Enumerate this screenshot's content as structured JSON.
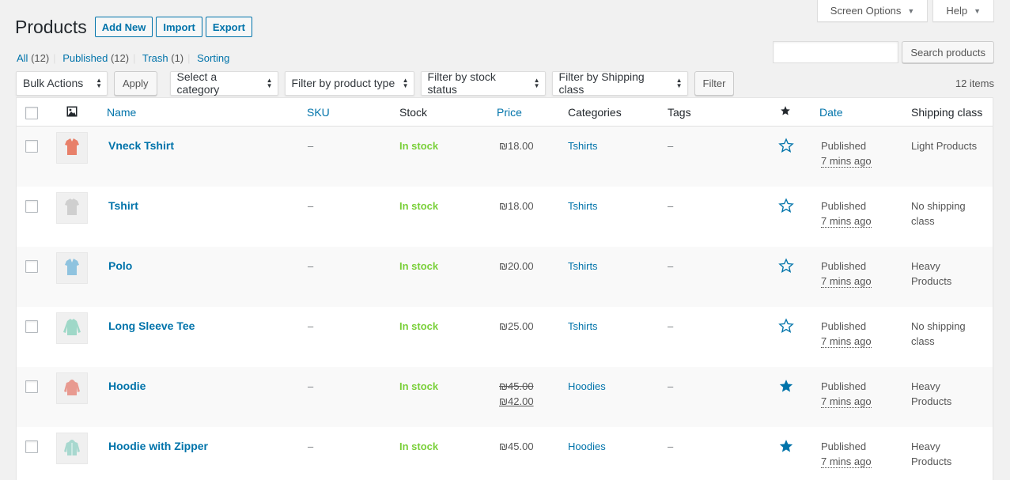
{
  "screen_meta": {
    "screen_options": "Screen Options",
    "help": "Help"
  },
  "header": {
    "title": "Products",
    "add_new": "Add New",
    "import": "Import",
    "export": "Export"
  },
  "views": {
    "all": "All",
    "all_count": "(12)",
    "published": "Published",
    "published_count": "(12)",
    "trash": "Trash",
    "trash_count": "(1)",
    "sorting": "Sorting",
    "separator": "|"
  },
  "search": {
    "value": "",
    "button": "Search products"
  },
  "tablenav": {
    "bulk_actions": "Bulk Actions",
    "apply": "Apply",
    "category": "Select a category",
    "product_type": "Filter by product type",
    "stock_status": "Filter by stock status",
    "shipping_class": "Filter by Shipping class",
    "filter": "Filter",
    "items": "12 items"
  },
  "columns": {
    "name": "Name",
    "sku": "SKU",
    "stock": "Stock",
    "price": "Price",
    "categories": "Categories",
    "tags": "Tags",
    "date": "Date",
    "shipping": "Shipping class"
  },
  "colors": {
    "accent": "#0073aa",
    "instock": "#7ad03a"
  },
  "rows": [
    {
      "name": "Vneck Tshirt",
      "sku": "–",
      "stock": "In stock",
      "price": "₪18.00",
      "price_regular": "",
      "category": "Tshirts",
      "tags": "–",
      "featured": false,
      "status": "Published",
      "time": "7 mins ago",
      "shipping_line1": "Light Products",
      "shipping_line2": "",
      "thumb_icon": "vneck-tshirt-icon",
      "thumb_color": "#e8806a"
    },
    {
      "name": "Tshirt",
      "sku": "–",
      "stock": "In stock",
      "price": "₪18.00",
      "price_regular": "",
      "category": "Tshirts",
      "tags": "–",
      "featured": false,
      "status": "Published",
      "time": "7 mins ago",
      "shipping_line1": "No shipping",
      "shipping_line2": "class",
      "thumb_icon": "tshirt-icon",
      "thumb_color": "#cfcfcf"
    },
    {
      "name": "Polo",
      "sku": "–",
      "stock": "In stock",
      "price": "₪20.00",
      "price_regular": "",
      "category": "Tshirts",
      "tags": "–",
      "featured": false,
      "status": "Published",
      "time": "7 mins ago",
      "shipping_line1": "Heavy",
      "shipping_line2": "Products",
      "thumb_icon": "polo-icon",
      "thumb_color": "#8fc3df"
    },
    {
      "name": "Long Sleeve Tee",
      "sku": "–",
      "stock": "In stock",
      "price": "₪25.00",
      "price_regular": "",
      "category": "Tshirts",
      "tags": "–",
      "featured": false,
      "status": "Published",
      "time": "7 mins ago",
      "shipping_line1": "No shipping",
      "shipping_line2": "class",
      "thumb_icon": "long-sleeve-tee-icon",
      "thumb_color": "#9fd8c8"
    },
    {
      "name": "Hoodie",
      "sku": "–",
      "stock": "In stock",
      "price": "₪42.00",
      "price_regular": "₪45.00",
      "category": "Hoodies",
      "tags": "–",
      "featured": true,
      "status": "Published",
      "time": "7 mins ago",
      "shipping_line1": "Heavy",
      "shipping_line2": "Products",
      "thumb_icon": "hoodie-icon",
      "thumb_color": "#e89a90"
    },
    {
      "name": "Hoodie with Zipper",
      "sku": "–",
      "stock": "In stock",
      "price": "₪45.00",
      "price_regular": "",
      "category": "Hoodies",
      "tags": "–",
      "featured": true,
      "status": "Published",
      "time": "7 mins ago",
      "shipping_line1": "Heavy",
      "shipping_line2": "Products",
      "thumb_icon": "zip-hoodie-icon",
      "thumb_color": "#a8d8cf"
    }
  ]
}
